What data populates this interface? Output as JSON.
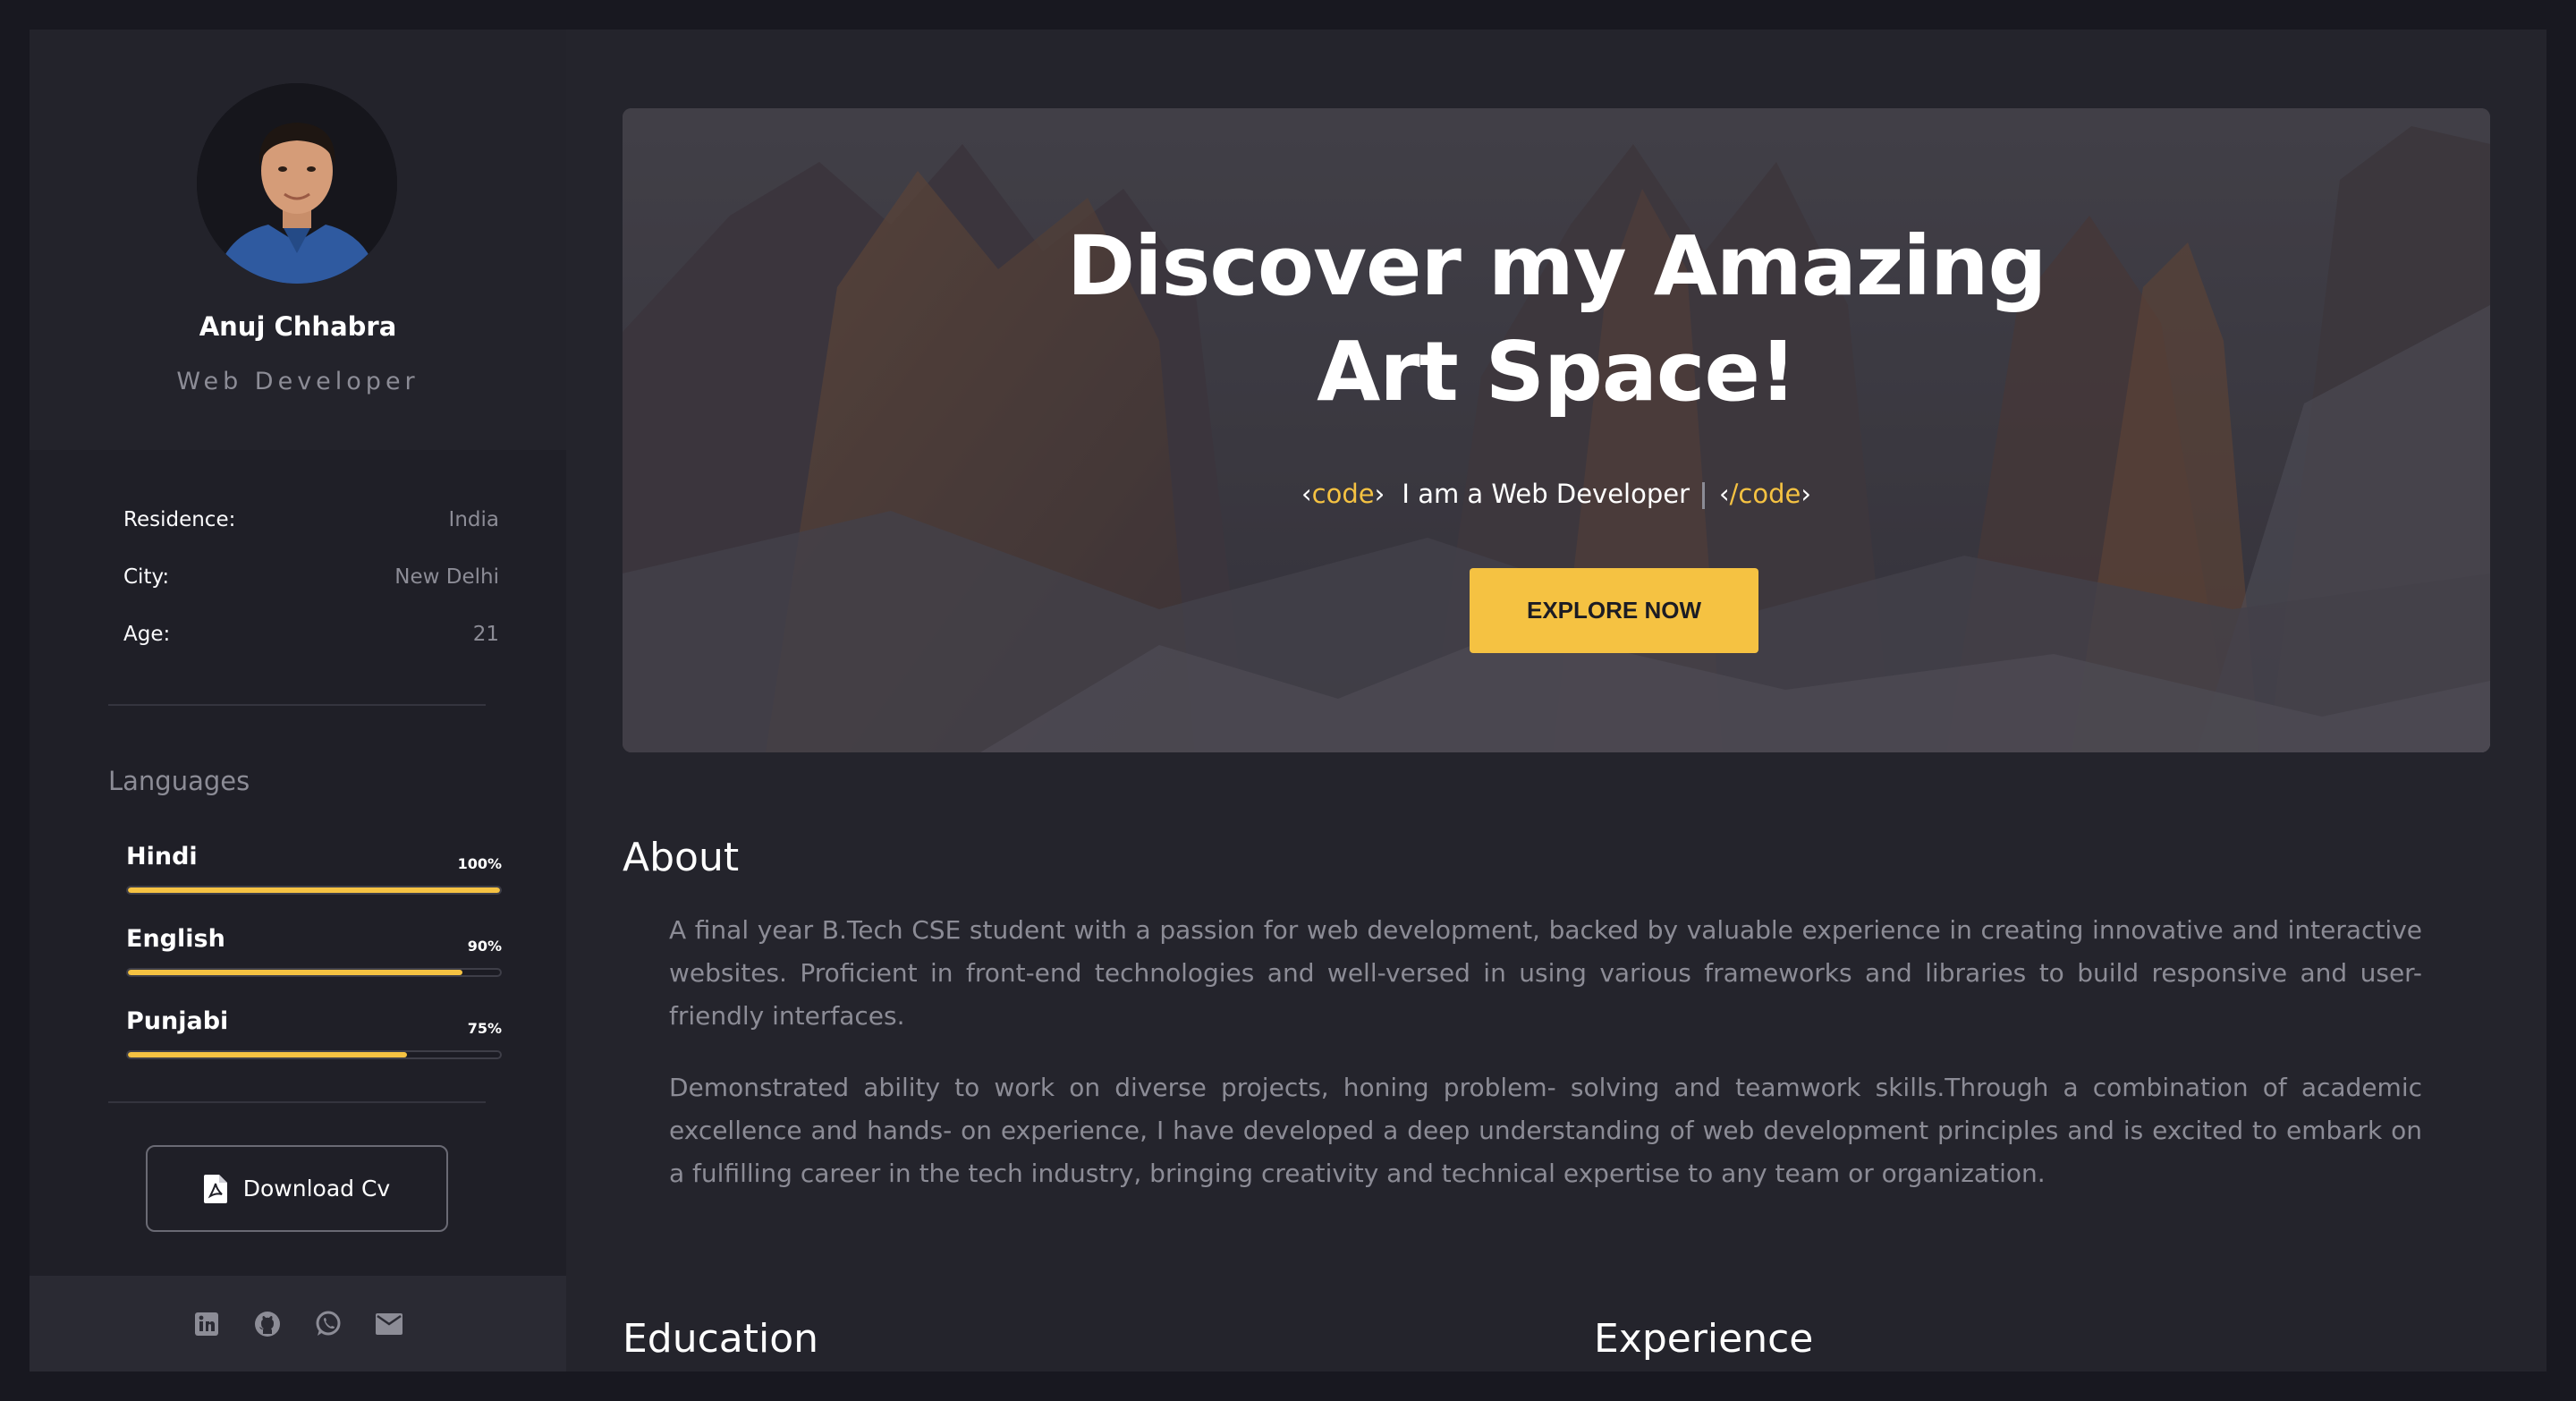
{
  "profile": {
    "name": "Anuj Chhabra",
    "role": "Web Developer"
  },
  "info": [
    {
      "label": "Residence:",
      "value": "India"
    },
    {
      "label": "City:",
      "value": "New Delhi"
    },
    {
      "label": "Age:",
      "value": "21"
    }
  ],
  "languages": {
    "title": "Languages",
    "items": [
      {
        "name": "Hindi",
        "percent_label": "100%",
        "level": 1.0
      },
      {
        "name": "English",
        "percent_label": "90%",
        "level": 0.9
      },
      {
        "name": "Punjabi",
        "percent_label": "75%",
        "level": 0.75
      }
    ]
  },
  "download": {
    "label": "Download Cv",
    "icon": "pdf-file-icon"
  },
  "social": [
    "linkedin-icon",
    "github-icon",
    "whatsapp-icon",
    "mail-icon"
  ],
  "hero": {
    "title_line1": "Discover my Amazing",
    "title_line2": "Art Space!",
    "code_open": "code",
    "code_close": "/code",
    "typed_text": "I am a Web Developer",
    "cta": "EXPLORE NOW"
  },
  "about": {
    "title": "About",
    "p1": "A final year B.Tech CSE student with a passion for web development, backed by valuable experience in creating innovative and interactive websites. Proficient in front-end technologies and well-versed in using various frameworks and libraries to build responsive and user-friendly interfaces.",
    "p2": "Demonstrated ability to work on diverse projects, honing problem- solving and teamwork skills.Through a combination of academic excellence and hands- on experience, I have developed a deep understanding of web development principles and is excited to embark on a fulfilling career in the tech industry, bringing creativity and technical expertise to any team or organization."
  },
  "sections": {
    "education": "Education",
    "experience": "Experience"
  },
  "colors": {
    "accent": "#f5c242",
    "background": "#24242c",
    "sidebar": "#1f1f27",
    "muted_text": "#8c8c96"
  }
}
